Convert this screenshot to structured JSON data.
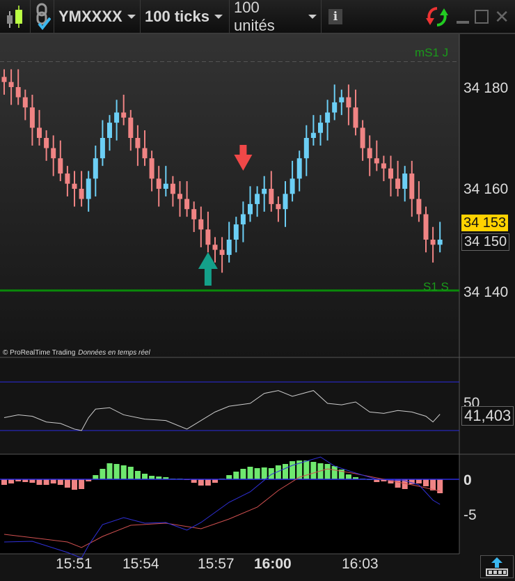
{
  "toolbar": {
    "symbol": "YMXXXX",
    "interval": "100 ticks",
    "units": "100 unités",
    "icons": [
      "candlestick-icon",
      "link-check-icon",
      "info-icon",
      "refresh-icon",
      "minimize-icon",
      "maximize-icon",
      "close-icon"
    ]
  },
  "price_panel": {
    "axis_ticks": [
      "34 180",
      "34 160",
      "34 140"
    ],
    "current_price": "34 153",
    "last_label": "34 150",
    "level_top": "mS1 J",
    "level_support": "S1 S",
    "credit": "© ProRealTime Trading",
    "credit_sub": "Données en temps réel"
  },
  "rsi_panel": {
    "tick": "50",
    "value": "41,403"
  },
  "macd_panel": {
    "ticks": [
      "0",
      "-5"
    ]
  },
  "time_axis": [
    "15:51",
    "15:54",
    "15:57",
    "16:00",
    "16:03"
  ],
  "colors": {
    "up": "#6ccff5",
    "down": "#f08484",
    "hist_up": "#6fe86f",
    "hist_down": "#f08484",
    "macd": "#3030d8",
    "signal": "#d05050",
    "level": "#0a8a0a"
  },
  "chart_data": [
    {
      "type": "candlestick",
      "title": "YMXXXX 100 ticks",
      "ylim": [
        34128,
        34193
      ],
      "closes": [
        34181,
        34180,
        34178,
        34176,
        34172,
        34170,
        34168,
        34166,
        34163,
        34161,
        34160,
        34158,
        34162,
        34166,
        34170,
        34173,
        34175,
        34174,
        34170,
        34168,
        34166,
        34162,
        34160,
        34161,
        34159,
        34158,
        34156,
        34154,
        34152,
        34149,
        34148,
        34147,
        34150,
        34153,
        34155,
        34157,
        34159,
        34160,
        34157,
        34156,
        34159,
        34162,
        34166,
        34170,
        34171,
        34173,
        34175,
        34177,
        34178,
        34176,
        34172,
        34168,
        34166,
        34165,
        34164,
        34162,
        34160,
        34163,
        34158,
        34155,
        34150,
        34149,
        34150
      ],
      "levels": [
        {
          "name": "mS1 J",
          "value": 34185
        },
        {
          "name": "S1 S",
          "value": 34140
        }
      ],
      "signals": [
        {
          "type": "buy",
          "bar": 29
        },
        {
          "type": "sell",
          "bar": 34
        }
      ]
    },
    {
      "type": "line",
      "name": "RSI",
      "ylim": [
        12,
        82
      ],
      "levels": [
        30,
        64
      ],
      "points": [
        [
          0,
          39
        ],
        [
          2,
          41
        ],
        [
          4,
          40
        ],
        [
          6,
          36
        ],
        [
          8,
          35
        ],
        [
          10,
          31
        ],
        [
          11,
          30
        ],
        [
          12,
          39
        ],
        [
          13,
          45
        ],
        [
          15,
          46
        ],
        [
          17,
          41
        ],
        [
          20,
          38
        ],
        [
          23,
          37
        ],
        [
          26,
          31
        ],
        [
          27,
          34
        ],
        [
          30,
          43
        ],
        [
          32,
          47
        ],
        [
          35,
          49
        ],
        [
          37,
          56
        ],
        [
          39,
          58
        ],
        [
          41,
          54
        ],
        [
          44,
          58
        ],
        [
          46,
          49
        ],
        [
          48,
          48
        ],
        [
          50,
          50
        ],
        [
          52,
          43
        ],
        [
          54,
          42
        ],
        [
          56,
          44
        ],
        [
          58,
          43
        ],
        [
          60,
          40
        ],
        [
          61,
          36
        ],
        [
          62,
          41.4
        ]
      ]
    },
    {
      "type": "bar+line",
      "name": "MACD",
      "ylim": [
        -10.5,
        4
      ],
      "histogram": [
        -0.8,
        -0.6,
        -0.3,
        -0.4,
        -0.5,
        -0.8,
        -0.8,
        -0.6,
        -0.8,
        -1.2,
        -1.5,
        -1.4,
        -0.3,
        0.6,
        1.5,
        2.3,
        2.2,
        2.0,
        1.8,
        1.2,
        0.8,
        0.5,
        0.4,
        0.3,
        0.1,
        0.1,
        -0.1,
        -0.5,
        -0.9,
        -0.9,
        -0.5,
        0.1,
        0.6,
        1.1,
        1.5,
        1.8,
        1.6,
        1.7,
        1.6,
        2.0,
        2.2,
        2.6,
        2.7,
        2.7,
        2.5,
        2.3,
        2.2,
        1.9,
        1.4,
        0.7,
        0.3,
        0.1,
        0,
        -0.4,
        -0.3,
        -0.6,
        -1.2,
        -1.4,
        -0.7,
        -0.6,
        -1.0,
        -1.6,
        -2.0
      ],
      "macd": [
        [
          0,
          -9
        ],
        [
          4,
          -8.9
        ],
        [
          9,
          -10.5
        ],
        [
          11,
          -11.3
        ],
        [
          12,
          -9.5
        ],
        [
          14,
          -6.5
        ],
        [
          17,
          -5.5
        ],
        [
          20,
          -6.3
        ],
        [
          23,
          -6.2
        ],
        [
          26,
          -7.3
        ],
        [
          28,
          -6.2
        ],
        [
          32,
          -3.3
        ],
        [
          35,
          -1.8
        ],
        [
          38,
          0.7
        ],
        [
          41,
          2.0
        ],
        [
          45,
          3.2
        ],
        [
          47,
          1.9
        ],
        [
          50,
          0.9
        ],
        [
          53,
          0
        ],
        [
          57,
          -0.2
        ],
        [
          59,
          -0.8
        ],
        [
          61,
          -3.0
        ],
        [
          62,
          -3.6
        ]
      ],
      "signal": [
        [
          0,
          -7.9
        ],
        [
          5,
          -8.5
        ],
        [
          9,
          -9.0
        ],
        [
          11,
          -9.8
        ],
        [
          14,
          -8.2
        ],
        [
          18,
          -6.6
        ],
        [
          23,
          -6.3
        ],
        [
          28,
          -7.1
        ],
        [
          32,
          -5.7
        ],
        [
          36,
          -4.0
        ],
        [
          39,
          -1.6
        ],
        [
          42,
          0.3
        ],
        [
          46,
          1.5
        ],
        [
          50,
          0.8
        ],
        [
          55,
          -0.2
        ],
        [
          59,
          -1.0
        ],
        [
          62,
          -1.7
        ]
      ]
    }
  ]
}
